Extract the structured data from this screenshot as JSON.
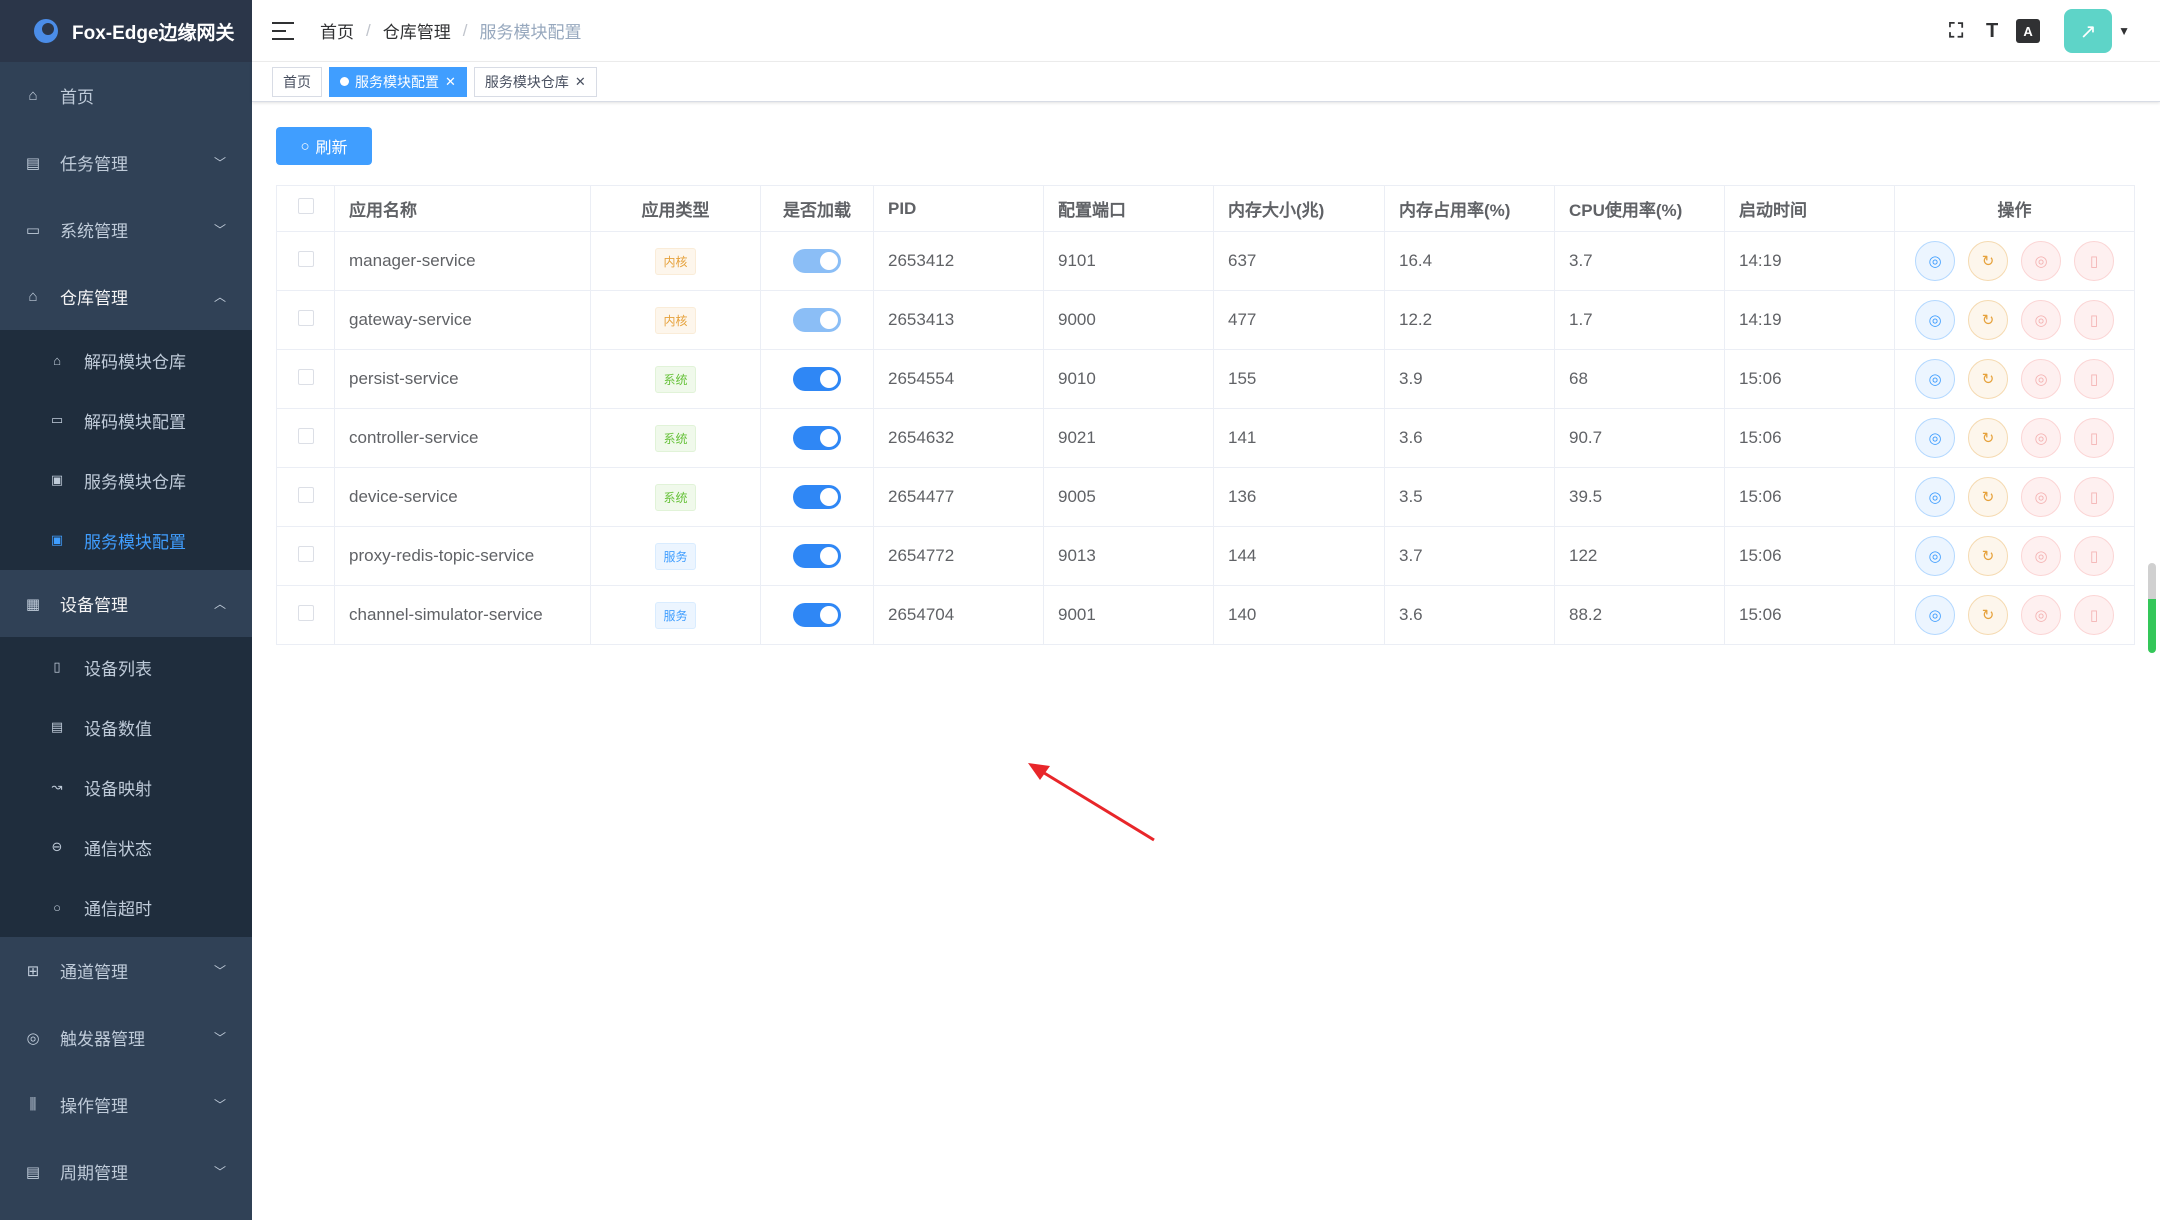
{
  "app": {
    "title": "Fox-Edge边缘网关"
  },
  "sidebar": {
    "items": [
      {
        "label": "首页",
        "icon": "home-icon"
      },
      {
        "label": "任务管理",
        "icon": "task-icon"
      },
      {
        "label": "系统管理",
        "icon": "system-icon"
      },
      {
        "label": "仓库管理",
        "icon": "repository-icon",
        "open": true,
        "children": [
          {
            "label": "解码模块仓库",
            "icon": "decoder-repo-icon"
          },
          {
            "label": "解码模块配置",
            "icon": "decoder-config-icon"
          },
          {
            "label": "服务模块仓库",
            "icon": "service-repo-icon"
          },
          {
            "label": "服务模块配置",
            "icon": "service-config-icon",
            "active": true
          }
        ]
      },
      {
        "label": "设备管理",
        "icon": "device-icon",
        "open": true,
        "children": [
          {
            "label": "设备列表",
            "icon": "device-list-icon"
          },
          {
            "label": "设备数值",
            "icon": "device-value-icon"
          },
          {
            "label": "设备映射",
            "icon": "device-map-icon"
          },
          {
            "label": "通信状态",
            "icon": "comm-status-icon"
          },
          {
            "label": "通信超时",
            "icon": "comm-timeout-icon"
          }
        ]
      },
      {
        "label": "通道管理",
        "icon": "channel-icon"
      },
      {
        "label": "触发器管理",
        "icon": "trigger-icon"
      },
      {
        "label": "操作管理",
        "icon": "operate-icon"
      },
      {
        "label": "周期管理",
        "icon": "period-icon"
      }
    ]
  },
  "header": {
    "breadcrumb": [
      "首页",
      "仓库管理",
      "服务模块配置"
    ]
  },
  "tags": [
    {
      "label": "首页",
      "active": false,
      "closable": false
    },
    {
      "label": "服务模块配置",
      "active": true,
      "closable": true
    },
    {
      "label": "服务模块仓库",
      "active": false,
      "closable": true
    }
  ],
  "toolbar": {
    "refresh_label": "刷新"
  },
  "table": {
    "headers": [
      "应用名称",
      "应用类型",
      "是否加载",
      "PID",
      "配置端口",
      "内存大小(兆)",
      "内存占用率(%)",
      "CPU使用率(%)",
      "启动时间",
      "操作"
    ],
    "rows": [
      {
        "name": "manager-service",
        "type": "内核",
        "type_class": "kernel",
        "loaded": true,
        "locked": true,
        "pid": "2653412",
        "port": "9101",
        "mem": "637",
        "mem_rate": "16.4",
        "cpu": "3.7",
        "start": "14:19"
      },
      {
        "name": "gateway-service",
        "type": "内核",
        "type_class": "kernel",
        "loaded": true,
        "locked": true,
        "pid": "2653413",
        "port": "9000",
        "mem": "477",
        "mem_rate": "12.2",
        "cpu": "1.7",
        "start": "14:19"
      },
      {
        "name": "persist-service",
        "type": "系统",
        "type_class": "system",
        "loaded": true,
        "locked": false,
        "pid": "2654554",
        "port": "9010",
        "mem": "155",
        "mem_rate": "3.9",
        "cpu": "68",
        "start": "15:06"
      },
      {
        "name": "controller-service",
        "type": "系统",
        "type_class": "system",
        "loaded": true,
        "locked": false,
        "pid": "2654632",
        "port": "9021",
        "mem": "141",
        "mem_rate": "3.6",
        "cpu": "90.7",
        "start": "15:06"
      },
      {
        "name": "device-service",
        "type": "系统",
        "type_class": "system",
        "loaded": true,
        "locked": false,
        "pid": "2654477",
        "port": "9005",
        "mem": "136",
        "mem_rate": "3.5",
        "cpu": "39.5",
        "start": "15:06"
      },
      {
        "name": "proxy-redis-topic-service",
        "type": "服务",
        "type_class": "service",
        "loaded": true,
        "locked": false,
        "pid": "2654772",
        "port": "9013",
        "mem": "144",
        "mem_rate": "3.7",
        "cpu": "122",
        "start": "15:06"
      },
      {
        "name": "channel-simulator-service",
        "type": "服务",
        "type_class": "service",
        "loaded": true,
        "locked": false,
        "pid": "2654704",
        "port": "9001",
        "mem": "140",
        "mem_rate": "3.6",
        "cpu": "88.2",
        "start": "15:06"
      }
    ]
  },
  "colors": {
    "primary": "#409eff",
    "sidebar_bg": "#304156",
    "annotation_arrow": "#e8262a"
  }
}
